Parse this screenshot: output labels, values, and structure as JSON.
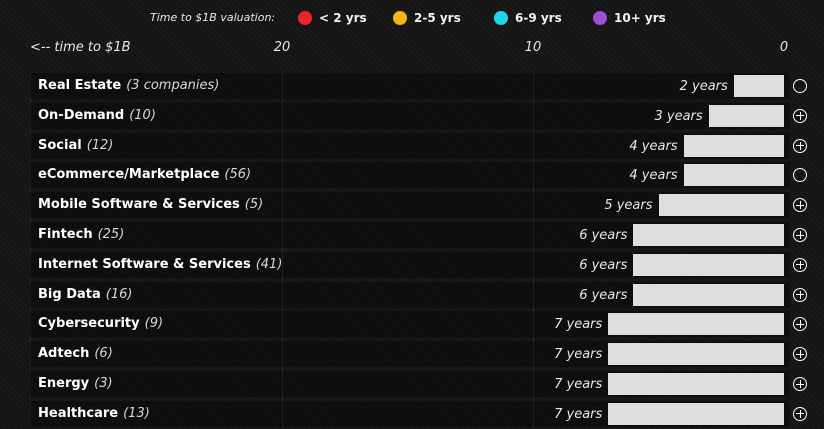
{
  "legend": {
    "title": "Time to $1B valuation:",
    "items": [
      {
        "label": "< 2 yrs",
        "color": "#e8262a"
      },
      {
        "label": "2-5 yrs",
        "color": "#f5b417"
      },
      {
        "label": "6-9 yrs",
        "color": "#1fd6e8"
      },
      {
        "label": "10+ yrs",
        "color": "#9a4fd6"
      }
    ]
  },
  "chart_data": {
    "type": "bar",
    "orientation": "horizontal",
    "direction": "reversed",
    "xlabel": "<-- time to $1B",
    "xlim": [
      21,
      0
    ],
    "x_ticks": [
      20,
      10,
      0
    ],
    "bar_color": "#dedede",
    "categories": [
      {
        "name": "Real Estate",
        "count": "(3 companies)",
        "value": 2,
        "value_label": "2 years",
        "expand_icon": "circle-icon"
      },
      {
        "name": "On-Demand",
        "count": "(10)",
        "value": 3,
        "value_label": "3 years",
        "expand_icon": "plus-circle-icon"
      },
      {
        "name": "Social",
        "count": "(12)",
        "value": 4,
        "value_label": "4 years",
        "expand_icon": "plus-circle-icon"
      },
      {
        "name": "eCommerce/Marketplace",
        "count": "(56)",
        "value": 4,
        "value_label": "4 years",
        "expand_icon": "circle-icon"
      },
      {
        "name": "Mobile Software & Services",
        "count": "(5)",
        "value": 5,
        "value_label": "5 years",
        "expand_icon": "plus-circle-icon"
      },
      {
        "name": "Fintech",
        "count": "(25)",
        "value": 6,
        "value_label": "6 years",
        "expand_icon": "plus-circle-icon"
      },
      {
        "name": "Internet Software & Services",
        "count": "(41)",
        "value": 6,
        "value_label": "6 years",
        "expand_icon": "plus-circle-icon"
      },
      {
        "name": "Big Data",
        "count": "(16)",
        "value": 6,
        "value_label": "6 years",
        "expand_icon": "plus-circle-icon"
      },
      {
        "name": "Cybersecurity",
        "count": "(9)",
        "value": 7,
        "value_label": "7 years",
        "expand_icon": "plus-circle-icon"
      },
      {
        "name": "Adtech",
        "count": "(6)",
        "value": 7,
        "value_label": "7 years",
        "expand_icon": "plus-circle-icon"
      },
      {
        "name": "Energy",
        "count": "(3)",
        "value": 7,
        "value_label": "7 years",
        "expand_icon": "plus-circle-icon"
      },
      {
        "name": "Healthcare",
        "count": "(13)",
        "value": 7,
        "value_label": "7 years",
        "expand_icon": "plus-circle-icon"
      }
    ]
  }
}
